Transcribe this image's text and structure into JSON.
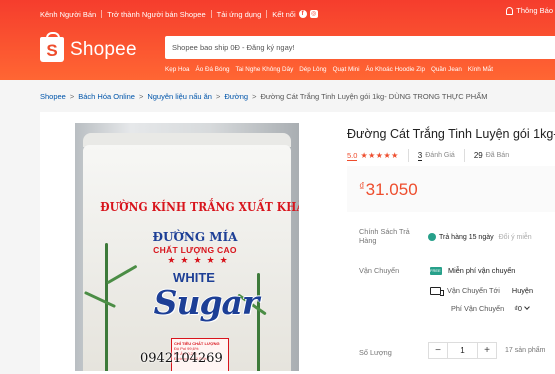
{
  "colors": {
    "brand": "#ee4d2d",
    "free_ship": "#27a08a",
    "link": "#0055aa"
  },
  "header": {
    "topbar": {
      "seller_center": "Kênh Người Bán",
      "become_seller": "Trở thành Người bán Shopee",
      "download_app": "Tải ứng dụng",
      "connect": "Kết nối",
      "facebook_icon": "f",
      "instagram_icon": "◎",
      "notifications": "Thông Báo"
    },
    "logo_text": "Shopee",
    "search": {
      "placeholder": "Shopee bao ship 0Đ - Đăng ký ngay!"
    },
    "hints": [
      "Kẹp Hoa",
      "Áo Đá Bóng",
      "Tai Nghe Không Dây",
      "Dép Lông",
      "Quạt Mini",
      "Áo Khoác Hoodie Zip",
      "Quần Jean",
      "Kính Mắt"
    ]
  },
  "breadcrumb": {
    "items": [
      "Shopee",
      "Bách Hóa Online",
      "Nguyên liệu nấu ăn",
      "Đường",
      "Đường Cát Trắng Tinh Luyện gói 1kg- DÙNG TRONG THỰC PHẨM"
    ],
    "separator": ">"
  },
  "product_image": {
    "brand_line": "ĐƯỜNG KÍNH TRẮNG XUẤT KHẨU",
    "sub_brand": "ĐƯỜNG MÍA",
    "quality": "CHẤT LƯỢNG CAO",
    "stars": "★★★★★",
    "white": "WHITE",
    "sugar": "Sugar",
    "spec_title": "CHỈ TIÊU CHẤT LƯỢNG",
    "spec_lines": [
      "Độ Pol 99,6%",
      "Độ Ẩm 0,2%",
      "Đường khử 0,05%"
    ],
    "phone": "0942104269"
  },
  "product": {
    "title": "Đường Cát Trắng Tinh Luyện gói 1kg-",
    "rating": "5.0",
    "rating_stars": "★★★★★",
    "review_count": "3",
    "review_label": "Đánh Giá",
    "sold_count": "29",
    "sold_label": "Đã Bán",
    "currency": "₫",
    "price": "31.050",
    "return_policy": {
      "label": "Chính Sách Trả Hàng",
      "value": "Trả hàng 15 ngày",
      "extra": "Đổi ý miễn"
    },
    "shipping": {
      "label": "Vận Chuyển",
      "free_ship_badge": "FREE SHIP",
      "free_ship": "Miễn phí vận chuyển",
      "ship_to_label": "Vận Chuyển Tới",
      "ship_to_value": "Huyện",
      "fee_label": "Phí Vận Chuyển",
      "fee_value": "₫0"
    },
    "quantity": {
      "label": "Số Lượng",
      "minus": "−",
      "value": "1",
      "plus": "+",
      "stock": "17 sản phẩm"
    }
  }
}
